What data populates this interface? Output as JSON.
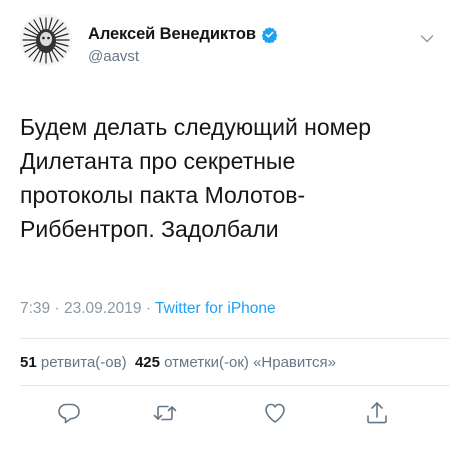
{
  "author": {
    "display_name": "Алексей Венедиктов",
    "handle": "@aavst",
    "verified": true
  },
  "tweet": {
    "text_lines": [
      "Будем делать следующий номер",
      "Дилетанта про секретные",
      "протоколы пакта Молотов-",
      "Риббентроп. Задолбали"
    ],
    "time": "7:39",
    "separator1": " · ",
    "date": "23.09.2019",
    "separator2": " · ",
    "source": "Twitter for iPhone"
  },
  "stats": {
    "retweets_count": "51",
    "retweets_label": "ретвита(-ов)",
    "likes_count": "425",
    "likes_label": "отметки(-ок) «Нравится»"
  },
  "icons": {
    "reply": "reply-icon",
    "retweet": "retweet-icon",
    "like": "heart-icon",
    "share": "share-icon",
    "verified": "verified-badge-icon",
    "more": "chevron-down-icon"
  },
  "colors": {
    "text": "#14171a",
    "secondary": "#657786",
    "link": "#1da1f2",
    "verified": "#1da1f2",
    "divider": "#e1e8ed"
  }
}
